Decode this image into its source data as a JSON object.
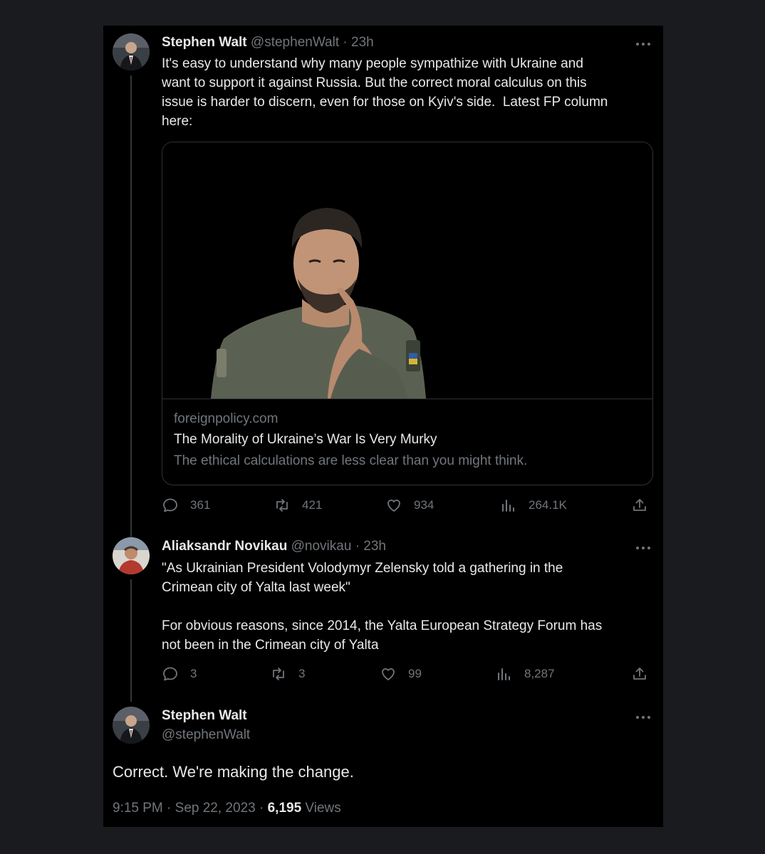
{
  "tweets": [
    {
      "name": "Stephen Walt",
      "handle": "@stephenWalt",
      "sep": "·",
      "time": "23h",
      "text": "It's easy to understand why many people sympathize with Ukraine and\nwant to support it against Russia. But the correct moral calculus on this\nissue is harder to discern, even for those on Kyiv's side.  Latest FP column\nhere:",
      "card": {
        "domain": "foreignpolicy.com",
        "title": "The Morality of Ukraine’s War Is Very Murky",
        "description": "The ethical calculations are less clear than you might think."
      },
      "stats": {
        "replies": "361",
        "reposts": "421",
        "likes": "934",
        "views": "264.1K"
      }
    },
    {
      "name": "Aliaksandr Novikau",
      "handle": "@novikau",
      "sep": "·",
      "time": "23h",
      "text": "\"As Ukrainian President Volodymyr Zelensky told a gathering in the\nCrimean city of Yalta last week\"\n\nFor obvious reasons, since 2014, the Yalta European Strategy Forum has\nnot been in the Crimean city of Yalta",
      "stats": {
        "replies": "3",
        "reposts": "3",
        "likes": "99",
        "views": "8,287"
      }
    }
  ],
  "main": {
    "name": "Stephen Walt",
    "handle": "@stephenWalt",
    "text": "Correct.  We're making the change.",
    "time": "9:15 PM",
    "sep": "·",
    "date": "Sep 22, 2023",
    "views_count": "6,195",
    "views_label": "Views"
  },
  "icons": [
    "reply-icon",
    "repost-icon",
    "like-icon",
    "views-icon",
    "share-icon",
    "more-icon"
  ]
}
